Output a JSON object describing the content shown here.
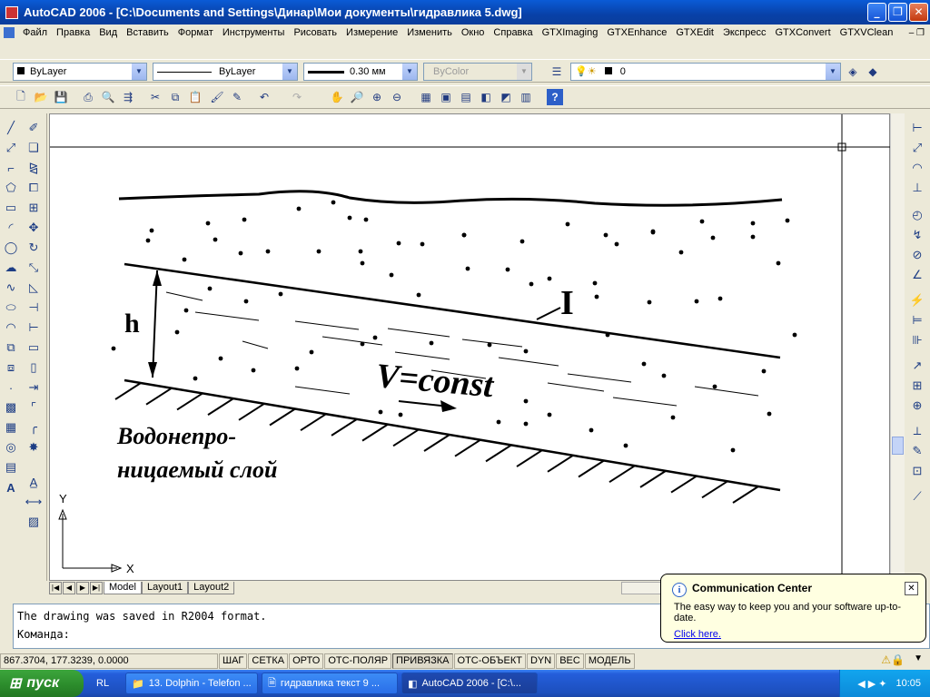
{
  "window": {
    "title": "AutoCAD 2006 - [C:\\Documents and Settings\\Динар\\Мои документы\\гидравлика 5.dwg]"
  },
  "menu": [
    "Файл",
    "Правка",
    "Вид",
    "Вставить",
    "Формат",
    "Инструменты",
    "Рисовать",
    "Измерение",
    "Изменить",
    "Окно",
    "Справка",
    "GTXImaging",
    "GTXEnhance",
    "GTXEdit",
    "Экспресс",
    "GTXConvert",
    "GTXVClean"
  ],
  "properties": {
    "color": "ByLayer",
    "linetype": "ByLayer",
    "lineweight": "0.30 мм",
    "plotstyle": "ByColor",
    "layer": "0"
  },
  "drawing": {
    "label_h": "h",
    "label_I": "I",
    "label_v": "V=const",
    "label_layer_line1": "Водонепро-",
    "label_layer_line2": "ницаемый слой",
    "ucs_x": "X",
    "ucs_y": "Y"
  },
  "layout_tabs": [
    "Model",
    "Layout1",
    "Layout2"
  ],
  "command": {
    "history": "The drawing was saved in R2004 format.",
    "prompt": "Команда:"
  },
  "status": {
    "coords": "867.3704, 177.3239, 0.0000",
    "toggles": [
      {
        "label": "ШАГ",
        "on": false
      },
      {
        "label": "СЕТКА",
        "on": false
      },
      {
        "label": "ОРТО",
        "on": false
      },
      {
        "label": "ОТС-ПОЛЯР",
        "on": false
      },
      {
        "label": "ПРИВЯЗКА",
        "on": true
      },
      {
        "label": "ОТС-ОБЪЕКТ",
        "on": false
      },
      {
        "label": "DYN",
        "on": false
      },
      {
        "label": "ВЕС",
        "on": false
      },
      {
        "label": "МОДЕЛЬ",
        "on": false
      }
    ]
  },
  "balloon": {
    "title": "Communication Center",
    "body": "The easy way to keep you and your software up-to-date.",
    "link": "Click here."
  },
  "taskbar": {
    "start": "пуск",
    "lang": "RL",
    "buttons": [
      "13. Dolphin - Telefon ...",
      "гидравлика текст 9 ...",
      "AutoCAD 2006 - [C:\\..."
    ],
    "clock": "10:05"
  }
}
